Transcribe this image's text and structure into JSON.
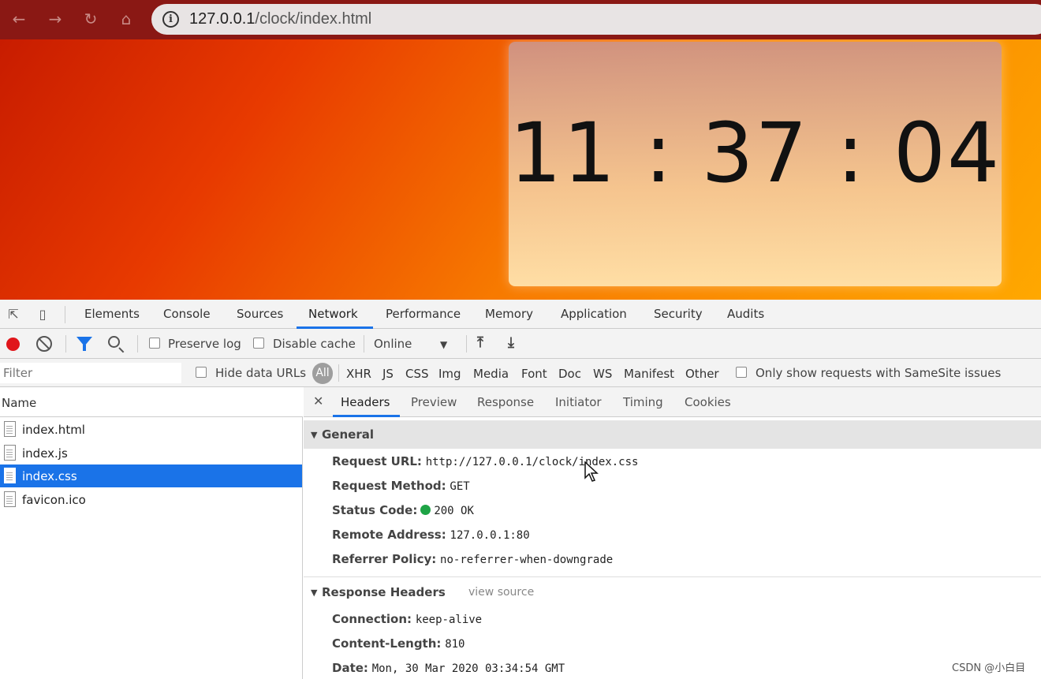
{
  "browser": {
    "url_host": "127.0.0.1",
    "url_path": "/clock/index.html",
    "back_icon": "arrow-left-icon",
    "forward_icon": "arrow-right-icon",
    "reload_icon": "reload-icon",
    "home_icon": "home-icon",
    "info_icon_glyph": "i"
  },
  "page": {
    "clock_time": "11 : 37 : 04"
  },
  "devtools": {
    "tabs": [
      "Elements",
      "Console",
      "Sources",
      "Network",
      "Performance",
      "Memory",
      "Application",
      "Security",
      "Audits"
    ],
    "active_tab": "Network",
    "toolbar": {
      "preserve_log": "Preserve log",
      "disable_cache": "Disable cache",
      "throttling": "Online"
    },
    "filter": {
      "placeholder": "Filter",
      "hide_data_urls": "Hide data URLs",
      "types": [
        "All",
        "XHR",
        "JS",
        "CSS",
        "Img",
        "Media",
        "Font",
        "Doc",
        "WS",
        "Manifest",
        "Other"
      ],
      "samesite": "Only show requests with SameSite issues"
    },
    "name_header": "Name",
    "requests": [
      "index.html",
      "index.js",
      "index.css",
      "favicon.ico"
    ],
    "selected_request": "index.css",
    "detail_tabs": [
      "Headers",
      "Preview",
      "Response",
      "Initiator",
      "Timing",
      "Cookies"
    ],
    "general": {
      "title": "General",
      "request_url_k": "Request URL:",
      "request_url_v": "http://127.0.0.1/clock/index.css",
      "method_k": "Request Method:",
      "method_v": "GET",
      "status_k": "Status Code:",
      "status_v": "200 OK",
      "remote_k": "Remote Address:",
      "remote_v": "127.0.0.1:80",
      "referrer_k": "Referrer Policy:",
      "referrer_v": "no-referrer-when-downgrade"
    },
    "response_headers": {
      "title": "Response Headers",
      "view_source": "view source",
      "connection_k": "Connection:",
      "connection_v": "keep-alive",
      "length_k": "Content-Length:",
      "length_v": "810",
      "date_k": "Date:",
      "date_v": "Mon, 30 Mar 2020 03:34:54 GMT"
    }
  },
  "watermark": "CSDN @小白目",
  "colors": {
    "accent": "#1a73e8",
    "record": "#e0161b",
    "status_ok": "#1ea446",
    "chrome": "#8a1814"
  }
}
